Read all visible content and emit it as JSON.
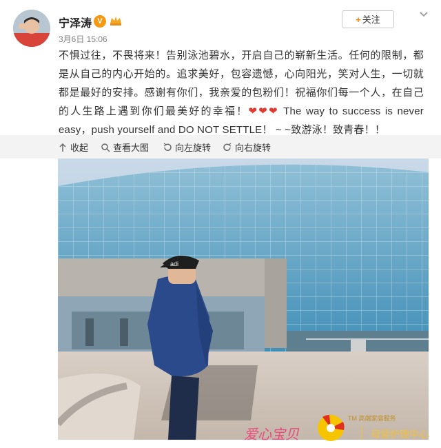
{
  "post": {
    "username": "宁泽涛",
    "verified_badge": "V",
    "vip_icon": "vip-crown-icon",
    "time": "3月6日 15:06",
    "follow_label": "关注",
    "text_before": "不惧过往，不畏将来！告别泳池碧水，开启自己的崭新生活。任何的限制，都是从自己的内心开始的。追求美好，包容遗憾，心向阳光，笑对人生，一切就都是最好的安排。感谢有你们，我亲爱的包粉们！祝福你们每一个人，在自己的人生路上遇到你们最美好的幸福！",
    "hearts": "❤❤❤",
    "text_after": " The way to success is never easy，push yourself and DO NOT SETTLE！ ~ ~致游泳！致青春！！"
  },
  "toolbar": {
    "collapse": "收起",
    "view_large": "查看大图",
    "rotate_left": "向左旋转",
    "rotate_right": "向右旋转"
  },
  "photo": {
    "cap_text": "adi"
  },
  "watermark": {
    "left_text": "爱心宝贝",
    "tm_text": "TM 高端家庭服务",
    "right_text": "母婴护理中心"
  },
  "colors": {
    "accent_orange": "#ff8200",
    "heart_red": "#e33a30",
    "sky": "#a7c2dc",
    "glass": "#5d9ec2"
  }
}
